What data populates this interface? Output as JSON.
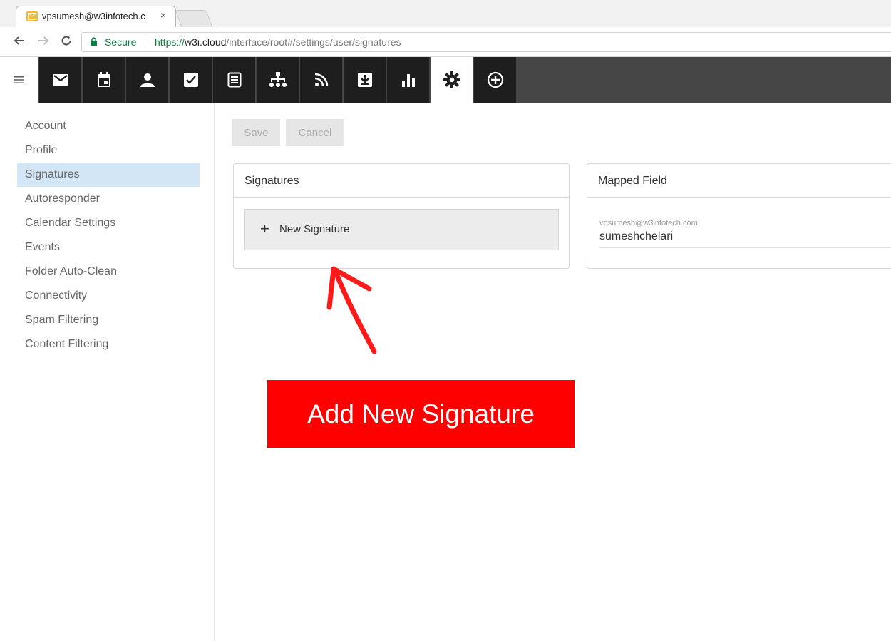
{
  "browser": {
    "tab_title": "vpsumesh@w3infotech.c",
    "tab_close": "×",
    "secure_label": "Secure",
    "url_proto": "https://",
    "url_host": "w3i.cloud",
    "url_path": "/interface/root#/settings/user/signatures"
  },
  "toolbar": {
    "items": [
      {
        "icon": "mail-icon"
      },
      {
        "icon": "calendar-icon"
      },
      {
        "icon": "contacts-icon"
      },
      {
        "icon": "tasks-icon"
      },
      {
        "icon": "notes-icon"
      },
      {
        "icon": "sitemap-icon"
      },
      {
        "icon": "rss-icon"
      },
      {
        "icon": "download-icon"
      },
      {
        "icon": "stats-icon"
      },
      {
        "icon": "gear-icon",
        "active": true
      },
      {
        "icon": "add-circle-icon"
      }
    ]
  },
  "sidebar": {
    "items": [
      {
        "label": "Account"
      },
      {
        "label": "Profile"
      },
      {
        "label": "Signatures",
        "active": true
      },
      {
        "label": "Autoresponder"
      },
      {
        "label": "Calendar Settings"
      },
      {
        "label": "Events"
      },
      {
        "label": "Folder Auto-Clean"
      },
      {
        "label": "Connectivity"
      },
      {
        "label": "Spam Filtering"
      },
      {
        "label": "Content Filtering"
      }
    ]
  },
  "actions": {
    "save_label": "Save",
    "cancel_label": "Cancel"
  },
  "signatures_panel": {
    "title": "Signatures",
    "new_label": "New Signature",
    "plus": "+"
  },
  "mapped_panel": {
    "title": "Mapped Field",
    "email": "vpsumesh@w3infotech.com",
    "value": "sumeshchelari"
  },
  "annotation": {
    "banner_text": "Add New Signature",
    "color": "#ff0000"
  }
}
